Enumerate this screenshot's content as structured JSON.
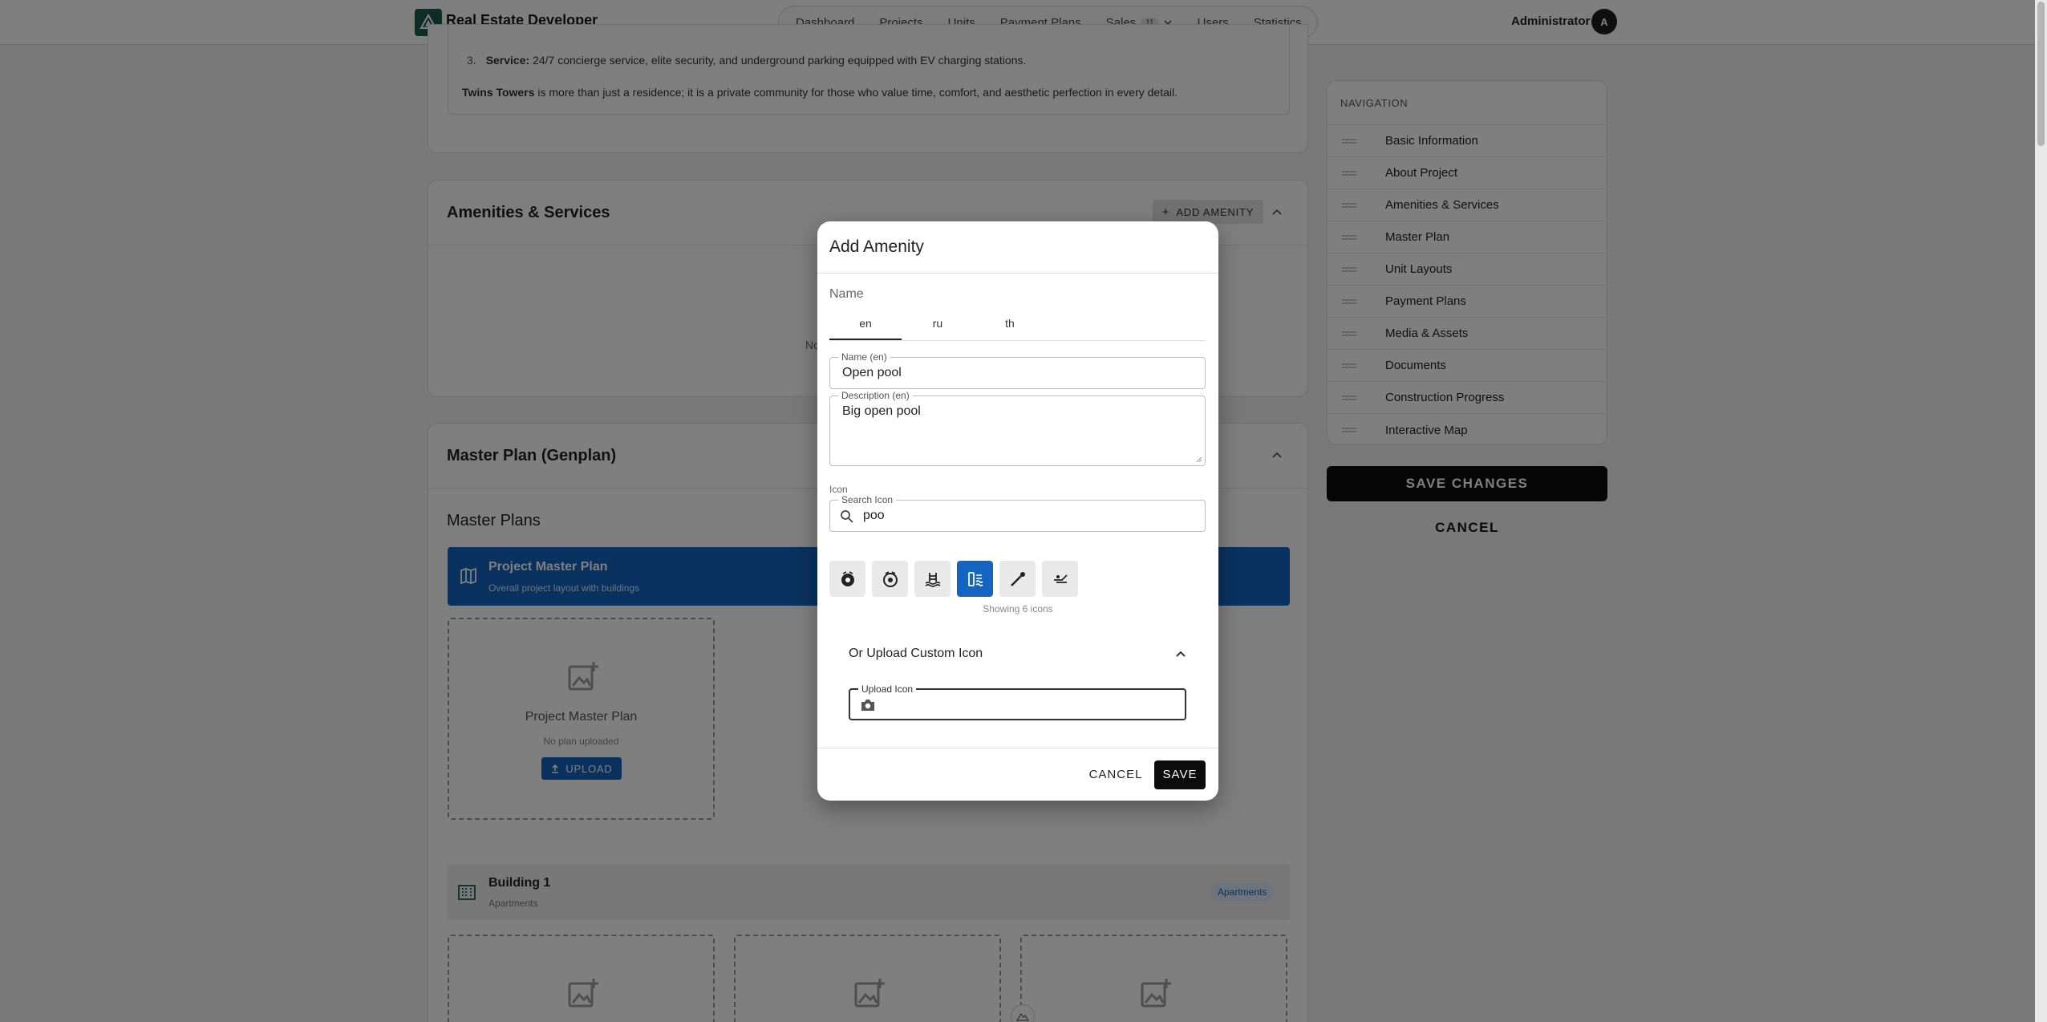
{
  "header": {
    "brand": "Real Estate Developer",
    "nav": [
      "Dashboard",
      "Projects",
      "Units",
      "Payment Plans",
      "Sales",
      "Users",
      "Statistics"
    ],
    "sales_badge": "11",
    "user_name": "Administrator",
    "avatar_letter": "A"
  },
  "about": {
    "item_number": "3.",
    "item_label": "Service:",
    "item_text": "24/7 concierge service, elite security, and underground parking equipped with EV charging stations.",
    "summary_bold": "Twins Towers",
    "summary_text": " is more than just a residence; it is a private community for those who value time, comfort, and aesthetic perfection in every detail."
  },
  "amenities": {
    "title": "Amenities & Services",
    "add_button": "ADD AMENITY",
    "empty_fragment": "No"
  },
  "master_plan": {
    "title": "Master Plan (Genplan)",
    "subtitle": "Master Plans",
    "banner_title": "Project Master Plan",
    "banner_subtitle": "Overall project layout with buildings",
    "upload_box_title": "Project Master Plan",
    "upload_box_status": "No plan uploaded",
    "upload_button": "UPLOAD",
    "building_title": "Building 1",
    "building_subtitle": "Apartments",
    "building_chip": "Apartments"
  },
  "side_nav": {
    "heading": "NAVIGATION",
    "items": [
      "Basic Information",
      "About Project",
      "Amenities & Services",
      "Master Plan",
      "Unit Layouts",
      "Payment Plans",
      "Media & Assets",
      "Documents",
      "Construction Progress",
      "Interactive Map"
    ],
    "save_label": "SAVE CHANGES",
    "cancel_label": "CANCEL"
  },
  "dialog": {
    "title": "Add Amenity",
    "name_section": "Name",
    "tabs": [
      "en",
      "ru",
      "th"
    ],
    "active_tab": "en",
    "name_label": "Name (en)",
    "name_value": "Open pool",
    "description_label": "Description (en)",
    "description_value": "Big open pool",
    "icon_section": "Icon",
    "search_label": "Search Icon",
    "search_value": "poo",
    "icons": [
      "pool-ball-icon",
      "pool-ball-outline-icon",
      "swimmer-icon",
      "pool-gauge-icon",
      "pool-cue-icon",
      "pool-ladder-icon"
    ],
    "selected_icon_index": 3,
    "icons_count_text": "Showing 6 icons",
    "upload_section": "Or Upload Custom Icon",
    "upload_label": "Upload Icon",
    "cancel_label": "CANCEL",
    "save_label": "SAVE"
  },
  "colors": {
    "accent_blue": "#1565c0",
    "primary_black": "#0c0c0c",
    "brand_green": "#1f5a4e",
    "chip_blue": "#dbe9f7"
  }
}
